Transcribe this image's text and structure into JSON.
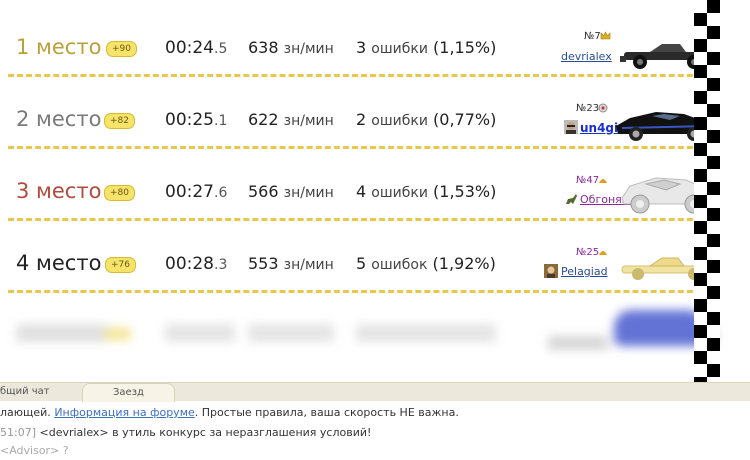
{
  "rows": [
    {
      "place": "1 место",
      "place_color": "#b8a23a",
      "bonus": "+90",
      "time_main": "00:24",
      "time_frac": ".5",
      "speed": "638",
      "speed_unit": "зн/мин",
      "errors": "3",
      "errors_word": "ошибки",
      "errors_pct": "(1,15%)",
      "rank": "№7",
      "user": "devrialex",
      "user_color": "#2a4a9a",
      "car": "black-formula"
    },
    {
      "place": "2 место",
      "place_color": "#7a7a7a",
      "bonus": "+82",
      "time_main": "00:25",
      "time_frac": ".1",
      "speed": "622",
      "speed_unit": "зн/мин",
      "errors": "2",
      "errors_word": "ошибки",
      "errors_pct": "(0,77%)",
      "rank": "№23",
      "user": "un4given",
      "user_color": "#1a2fd0",
      "car": "black-sports"
    },
    {
      "place": "3 место",
      "place_color": "#b24a3e",
      "bonus": "+80",
      "time_main": "00:27",
      "time_frac": ".6",
      "speed": "566",
      "speed_unit": "зн/мин",
      "errors": "4",
      "errors_word": "ошибки",
      "errors_pct": "(1,53%)",
      "rank": "№47",
      "user": "Обгоняша",
      "user_color": "#8a2a9a",
      "car": "white-buggy"
    },
    {
      "place": "4 место",
      "place_color": "#222222",
      "bonus": "+76",
      "time_main": "00:28",
      "time_frac": ".3",
      "speed": "553",
      "speed_unit": "зн/мин",
      "errors": "5",
      "errors_word": "ошибок",
      "errors_pct": "(1,92%)",
      "rank": "№25",
      "user": "Pelagiad",
      "user_color": "#2a4a9a",
      "car": "gold-formula"
    }
  ],
  "tabs": {
    "general": "бщий чат",
    "race": "Заезд"
  },
  "chat": {
    "line1_pre": "лающей.",
    "line1_link": "Информация на форуме",
    "line1_post": ". Простые правила, ваша скорость НЕ важна.",
    "line2_time": "51:07]",
    "line2_text": "<devrialex> в утиль конкурс за неразглашения условий!",
    "line3_text": "<Advisor> ?"
  }
}
